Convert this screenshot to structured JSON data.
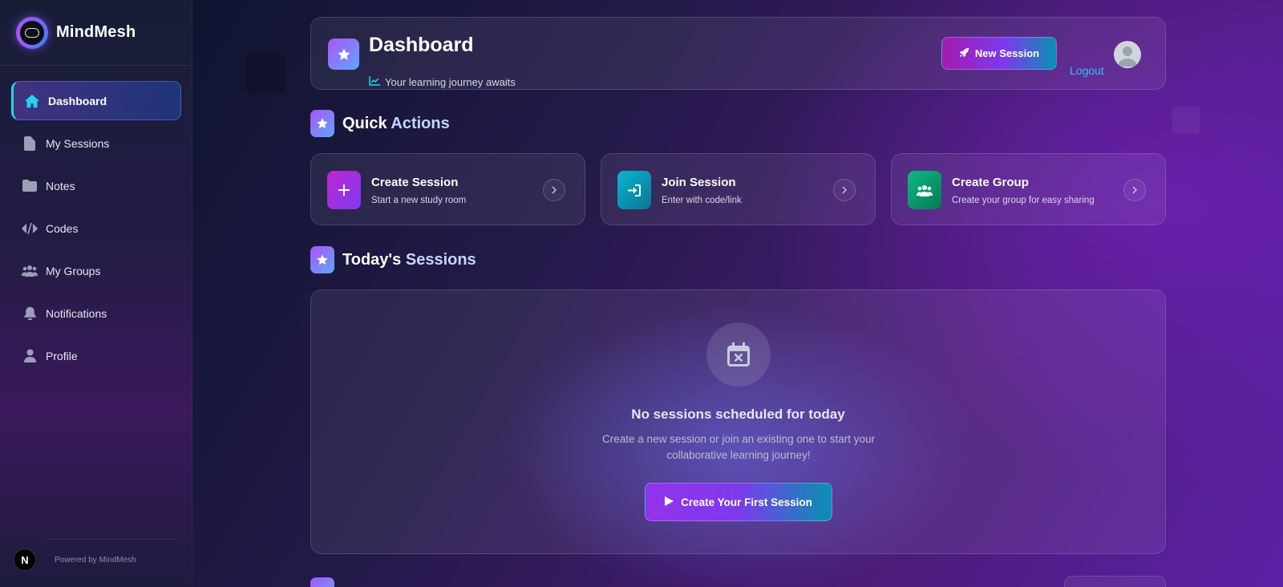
{
  "brand": {
    "name": "MindMesh"
  },
  "sidebar": {
    "items": [
      {
        "label": "Dashboard",
        "icon": "home-icon",
        "active": true
      },
      {
        "label": "My Sessions",
        "icon": "file-icon"
      },
      {
        "label": "Notes",
        "icon": "folder-icon"
      },
      {
        "label": "Codes",
        "icon": "code-icon"
      },
      {
        "label": "My Groups",
        "icon": "users-icon"
      },
      {
        "label": "Notifications",
        "icon": "bell-icon"
      },
      {
        "label": "Profile",
        "icon": "user-icon"
      }
    ],
    "footer_badge": "N",
    "footer_text": "Powered by MindMesh"
  },
  "header": {
    "title": "Dashboard",
    "subtitle": "Your learning journey awaits",
    "new_session_label": "New Session",
    "logout_label": "Logout"
  },
  "quick_actions": {
    "title_main": "Quick ",
    "title_accent": "Actions",
    "items": [
      {
        "title": "Create Session",
        "desc": "Start a new study room",
        "icon": "plus-icon",
        "color": "#a21caf"
      },
      {
        "title": "Join Session",
        "desc": "Enter with code/link",
        "icon": "sign-in-icon",
        "color": "#0891b2"
      },
      {
        "title": "Create Group",
        "desc": "Create your group for easy sharing",
        "icon": "users-icon",
        "color": "#059669"
      }
    ]
  },
  "today": {
    "title_main": "Today's ",
    "title_accent": "Sessions",
    "empty_title": "No sessions scheduled for today",
    "empty_desc": "Create a new session or join an existing one to start your collaborative learning journey!",
    "cta_label": "Create Your First Session"
  },
  "colors": {
    "accent": "#22d3ee",
    "link": "#38bdf8",
    "brand_purple": "#7c3aed"
  }
}
